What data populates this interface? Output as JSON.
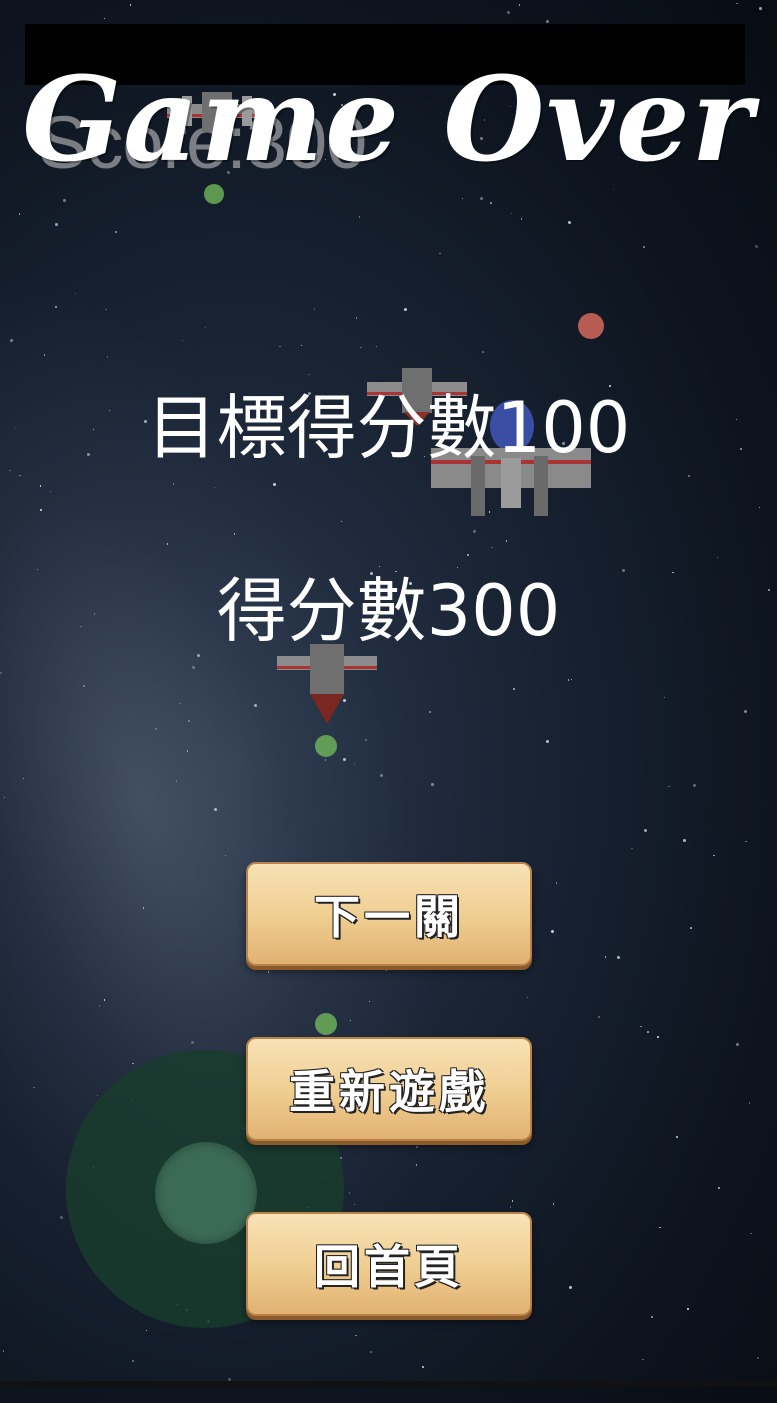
{
  "title": "Game Over",
  "score_ghost": "Score:300",
  "target_score_label": "目標得分數100",
  "score_label": "得分數300",
  "buttons": {
    "next_level": "下一關",
    "restart": "重新遊戲",
    "home": "回首頁"
  },
  "colors": {
    "button_fill": "#f0cf93",
    "button_border": "#b8834a",
    "joystick": "#183c2c",
    "bullet_green": "#7fd36b",
    "bullet_red": "#e0604e"
  }
}
